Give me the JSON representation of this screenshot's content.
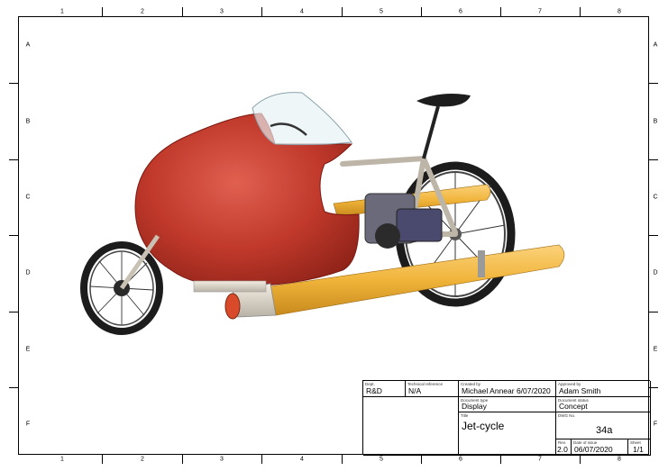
{
  "frame": {
    "columns": [
      "1",
      "2",
      "3",
      "4",
      "5",
      "6",
      "7",
      "8"
    ],
    "rows": [
      "A",
      "B",
      "C",
      "D",
      "E",
      "F"
    ]
  },
  "title_block": {
    "dept": {
      "caption": "Dept.",
      "value": "R&D"
    },
    "technical_reference": {
      "caption": "Technical reference",
      "value": "N/A"
    },
    "created_by": {
      "caption": "Created by",
      "value": "Michael Annear  6/07/2020"
    },
    "approved_by": {
      "caption": "Approved by",
      "value": "Adam Smith"
    },
    "document_type": {
      "caption": "Document type",
      "value": "Display"
    },
    "document_status": {
      "caption": "Document status",
      "value": "Concept"
    },
    "title": {
      "caption": "Title",
      "value": "Jet-cycle"
    },
    "dwg_no": {
      "caption": "DWG No.",
      "value": "34a"
    },
    "rev": {
      "caption": "Rev.",
      "value": "2.0"
    },
    "date_of_issue": {
      "caption": "Date of issue",
      "value": "06/07/2020"
    },
    "sheet": {
      "caption": "Sheet",
      "value": "1/1"
    }
  },
  "colors": {
    "fairing": "#c0392b",
    "tube": "#f0b43a",
    "frame": "#e8e2d6",
    "tyre": "#1c1c1c"
  }
}
